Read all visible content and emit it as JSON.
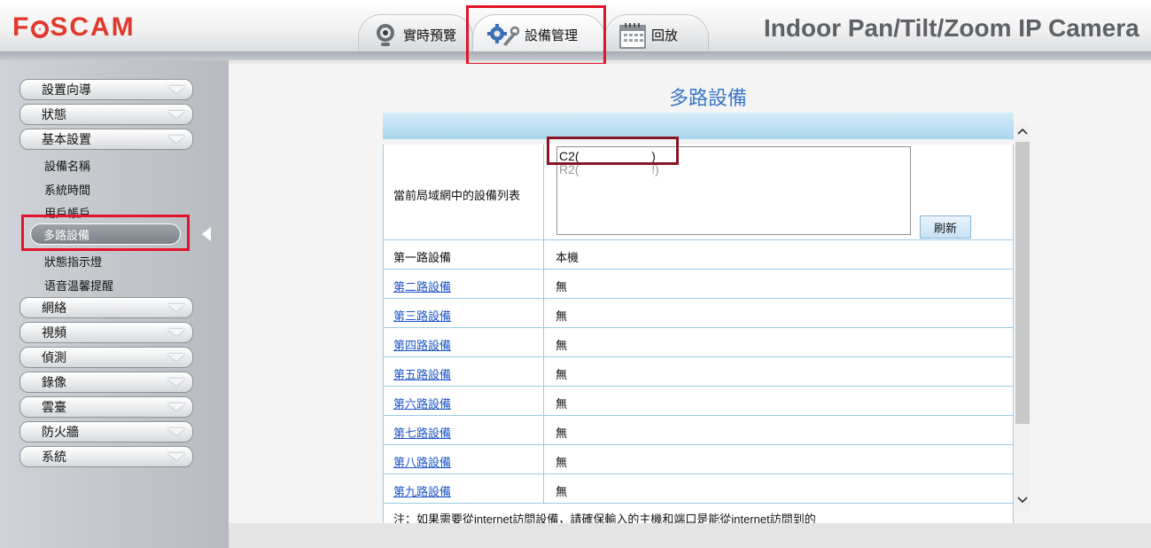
{
  "header": {
    "logo": "FOSCAM",
    "device_title": "Indoor Pan/Tilt/Zoom IP Camera",
    "tabs": [
      {
        "label": "實時預覽",
        "icon": "webcam-icon"
      },
      {
        "label": "設備管理",
        "icon": "tools-gear-icon"
      },
      {
        "label": "回放",
        "icon": "calendar-icon"
      }
    ]
  },
  "sidebar": {
    "menu_top": [
      {
        "label": "設置向導"
      },
      {
        "label": "狀態"
      },
      {
        "label": "基本設置"
      }
    ],
    "sub_items": [
      {
        "label": "設備名稱"
      },
      {
        "label": "系統時間"
      },
      {
        "label": "用戶帳戶"
      },
      {
        "label": "多路設備"
      },
      {
        "label": "狀態指示燈"
      },
      {
        "label": "语音温馨提醒"
      }
    ],
    "menu_bottom": [
      {
        "label": "網絡"
      },
      {
        "label": "視頻"
      },
      {
        "label": "偵測"
      },
      {
        "label": "錄像"
      },
      {
        "label": "雲臺"
      },
      {
        "label": "防火牆"
      },
      {
        "label": "系統"
      }
    ]
  },
  "main": {
    "title": "多路設備",
    "device_list_label": "當前局域網中的設備列表",
    "device_list": [
      "C2(                     )",
      "R2(                     !)"
    ],
    "refresh_label": "刷新",
    "rows": [
      {
        "label": "第一路設備",
        "value": "本機",
        "link": false
      },
      {
        "label": "第二路設備",
        "value": "無",
        "link": true
      },
      {
        "label": "第三路設備",
        "value": "無",
        "link": true
      },
      {
        "label": "第四路設備",
        "value": "無",
        "link": true
      },
      {
        "label": "第五路設備",
        "value": "無",
        "link": true
      },
      {
        "label": "第六路設備",
        "value": "無",
        "link": true
      },
      {
        "label": "第七路設備",
        "value": "無",
        "link": true
      },
      {
        "label": "第八路設備",
        "value": "無",
        "link": true
      },
      {
        "label": "第九路設備",
        "value": "無",
        "link": true
      }
    ],
    "note": "注：如果需要從internet訪問設備，請確保輸入的主機和端口是能從internet訪問到的"
  },
  "scrollbar": {
    "up": "^",
    "down": "v"
  },
  "colors": {
    "brand": "#e03a2e",
    "title": "#3b77c8",
    "link": "#1d55c4",
    "highlight": "#e3142a"
  }
}
